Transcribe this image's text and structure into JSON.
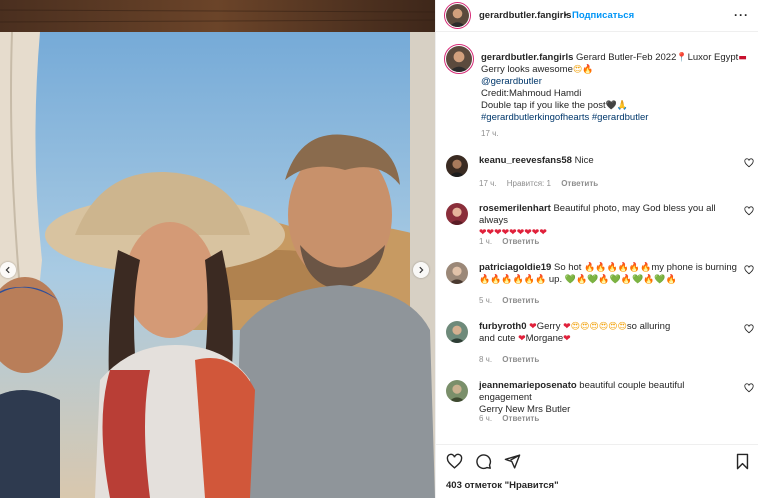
{
  "header": {
    "username": "gerardbutler.fangirls",
    "separator": "•",
    "follow_label": "Подписаться",
    "more_label": "···"
  },
  "caption": {
    "username": "gerardbutler.fangirls",
    "line1": " Gerard Butler-Feb 2022",
    "line1_tail": "Luxor Egypt",
    "line2": "Gerry looks awesome",
    "mention": "@gerardbutler",
    "credit": "Credit:Mahmoud Hamdi",
    "line5": "Double tap if you like the post",
    "hashtags": "#gerardbutlerkingofhearts #gerardbutler",
    "time": "17 ч."
  },
  "comments": [
    {
      "username": "keanu_reevesfans58",
      "text": " Nice",
      "time": "17 ч.",
      "likes": "Нравится: 1",
      "reply": "Ответить"
    },
    {
      "username": "rosemerilenhart",
      "text": " Beautiful photo, may God bless you all always",
      "emoji_line": "❤❤❤❤❤❤❤❤❤",
      "time": "1 ч.",
      "reply": "Ответить"
    },
    {
      "username": "patriciagoldie19",
      "text": " So hot ",
      "fires": "🔥🔥🔥🔥🔥🔥",
      "tail": "my phone is burning",
      "line2_fires": "🔥🔥🔥🔥🔥🔥",
      "line2_text": " up. ",
      "line2_emoji": "💚🔥💚🔥💚🔥💚🔥💚🔥",
      "time": "5 ч.",
      "reply": "Ответить"
    },
    {
      "username": "furbyroth0",
      "text_a": "Gerry ",
      "text_b": "so alluring",
      "text_c": "and cute ",
      "text_d": "Morgane",
      "time": "8 ч.",
      "reply": "Ответить"
    },
    {
      "username": "jeannemarieposenato",
      "text": " beautiful couple beautiful engagement",
      "line2": "Gerry New Mrs Butler",
      "time": "6 ч.",
      "reply": "Ответить"
    }
  ],
  "footer": {
    "likes_label": "403 отметок \"Нравится\""
  },
  "colors": {
    "accent": "#0095f6",
    "link": "#00376b",
    "muted": "#8e8e8e",
    "ring": "#d62976"
  },
  "icons": [
    "heart-icon",
    "comment-icon",
    "share-icon",
    "bookmark-icon",
    "chevron-left-icon",
    "chevron-right-icon",
    "more-icon"
  ]
}
